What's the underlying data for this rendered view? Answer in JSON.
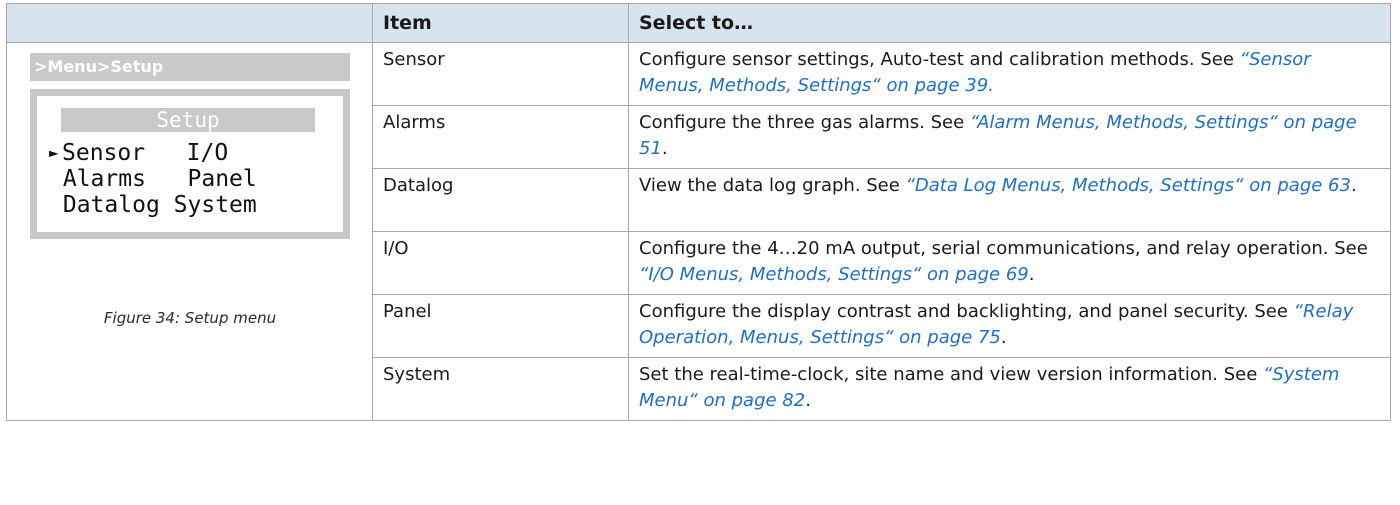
{
  "table": {
    "headers": {
      "blank": "",
      "item": "Item",
      "select": "Select to…"
    },
    "rows": [
      {
        "item": "Sensor",
        "text": "Configure sensor settings, Auto-test and calibration methods. See ",
        "xref": "“Sensor Menus, Methods, Settings“ on page 39.",
        "suffix": ""
      },
      {
        "item": "Alarms",
        "text": "Configure the three gas alarms. See ",
        "xref": "“Alarm Menus, Methods, Settings“ on page 51",
        "suffix": "."
      },
      {
        "item": "Datalog",
        "text": "View the data log graph. See ",
        "xref": "“Data Log Menus, Methods, Settings“ on page 63",
        "suffix": "."
      },
      {
        "item": "I/O",
        "text": "Configure the 4…20 mA output, serial communications, and relay operation. See ",
        "xref": "“I/O Menus, Methods, Settings“ on page 69",
        "suffix": "."
      },
      {
        "item": "Panel",
        "text": "Configure the display contrast and backlighting, and panel security. See ",
        "xref": "“Relay Operation, Menus, Settings“ on page 75",
        "suffix": "."
      },
      {
        "item": "System",
        "text": "Set the real-time-clock, site name and view version information. See ",
        "xref": "“System Menu“ on page 82",
        "suffix": "."
      }
    ]
  },
  "figure": {
    "path": ">Menu>Setup",
    "screen_title": "Setup",
    "selector": "►",
    "lines": [
      {
        "left": "Sensor",
        "right": "I/O"
      },
      {
        "left": "Alarms",
        "right": "Panel"
      },
      {
        "left": "Datalog",
        "right": "System"
      }
    ],
    "caption": "Figure 34:  Setup menu"
  },
  "colors": {
    "header_bg": "#d7e3ef",
    "link": "#1f6fc4",
    "lcd_gray": "#c9c9c9"
  }
}
